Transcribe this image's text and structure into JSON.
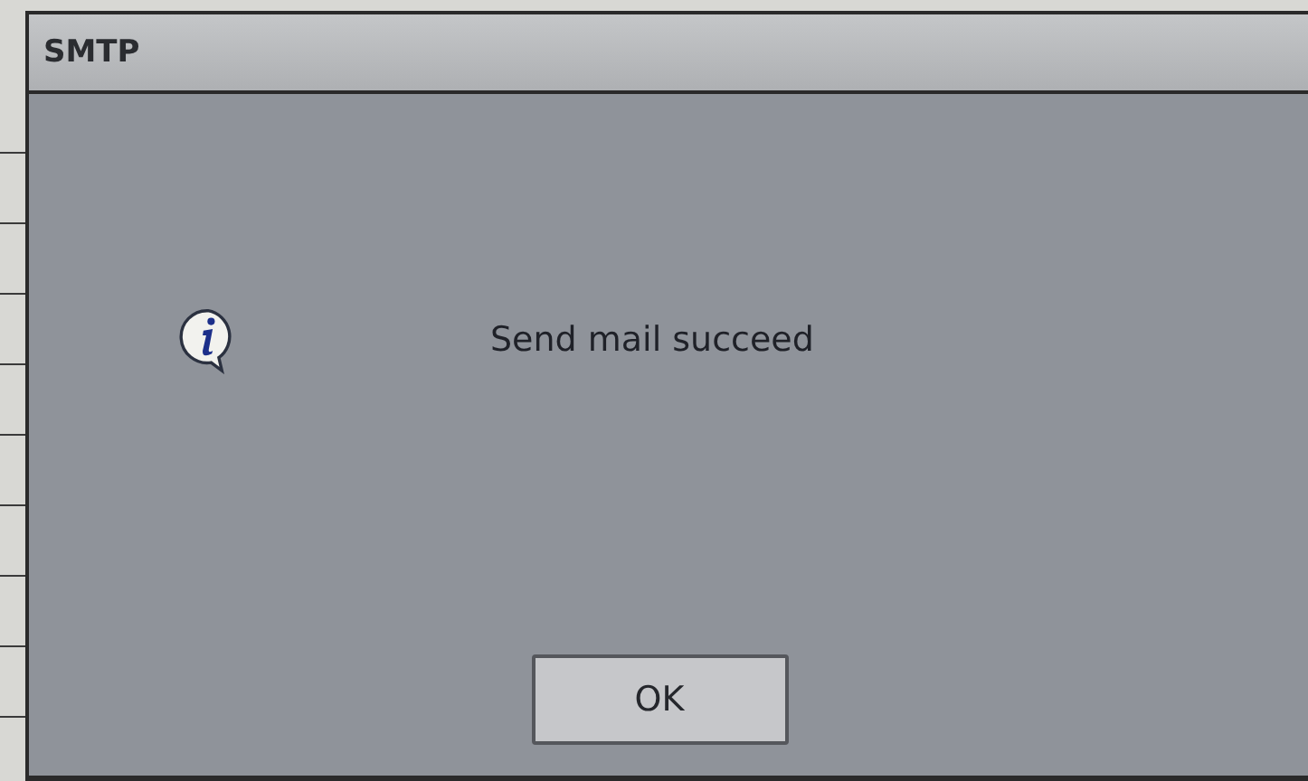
{
  "dialog": {
    "title": "SMTP",
    "message": "Send mail succeed",
    "buttons": [
      "OK"
    ]
  }
}
